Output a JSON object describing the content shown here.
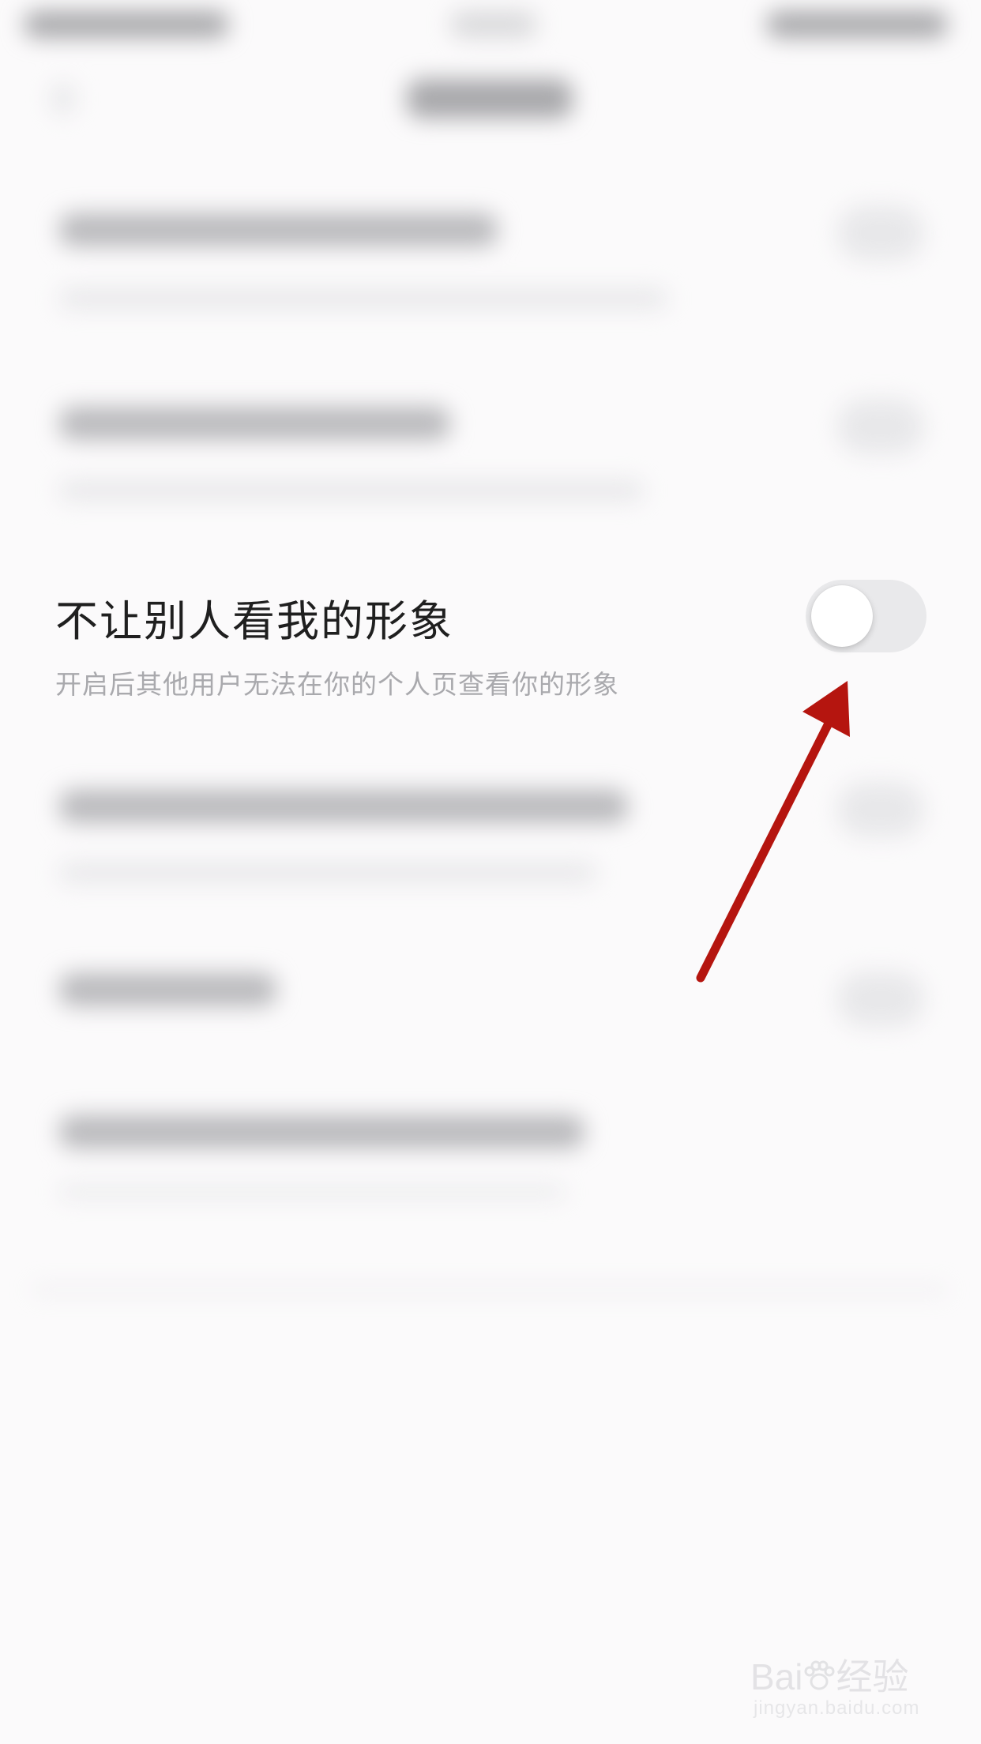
{
  "setting": {
    "title": "不让别人看我的形象",
    "description": "开启后其他用户无法在你的个人页查看你的形象",
    "toggle_on": false
  },
  "annotation": {
    "color": "#b5150f"
  },
  "watermark": {
    "brand_left": "Bai",
    "brand_right": "经验",
    "url": "jingyan.baidu.com"
  },
  "colors": {
    "background": "#fbfafb",
    "toggle_track_off": "#e9e9eb",
    "title_text": "#1f1f1f",
    "desc_text": "#a9a9ad"
  }
}
